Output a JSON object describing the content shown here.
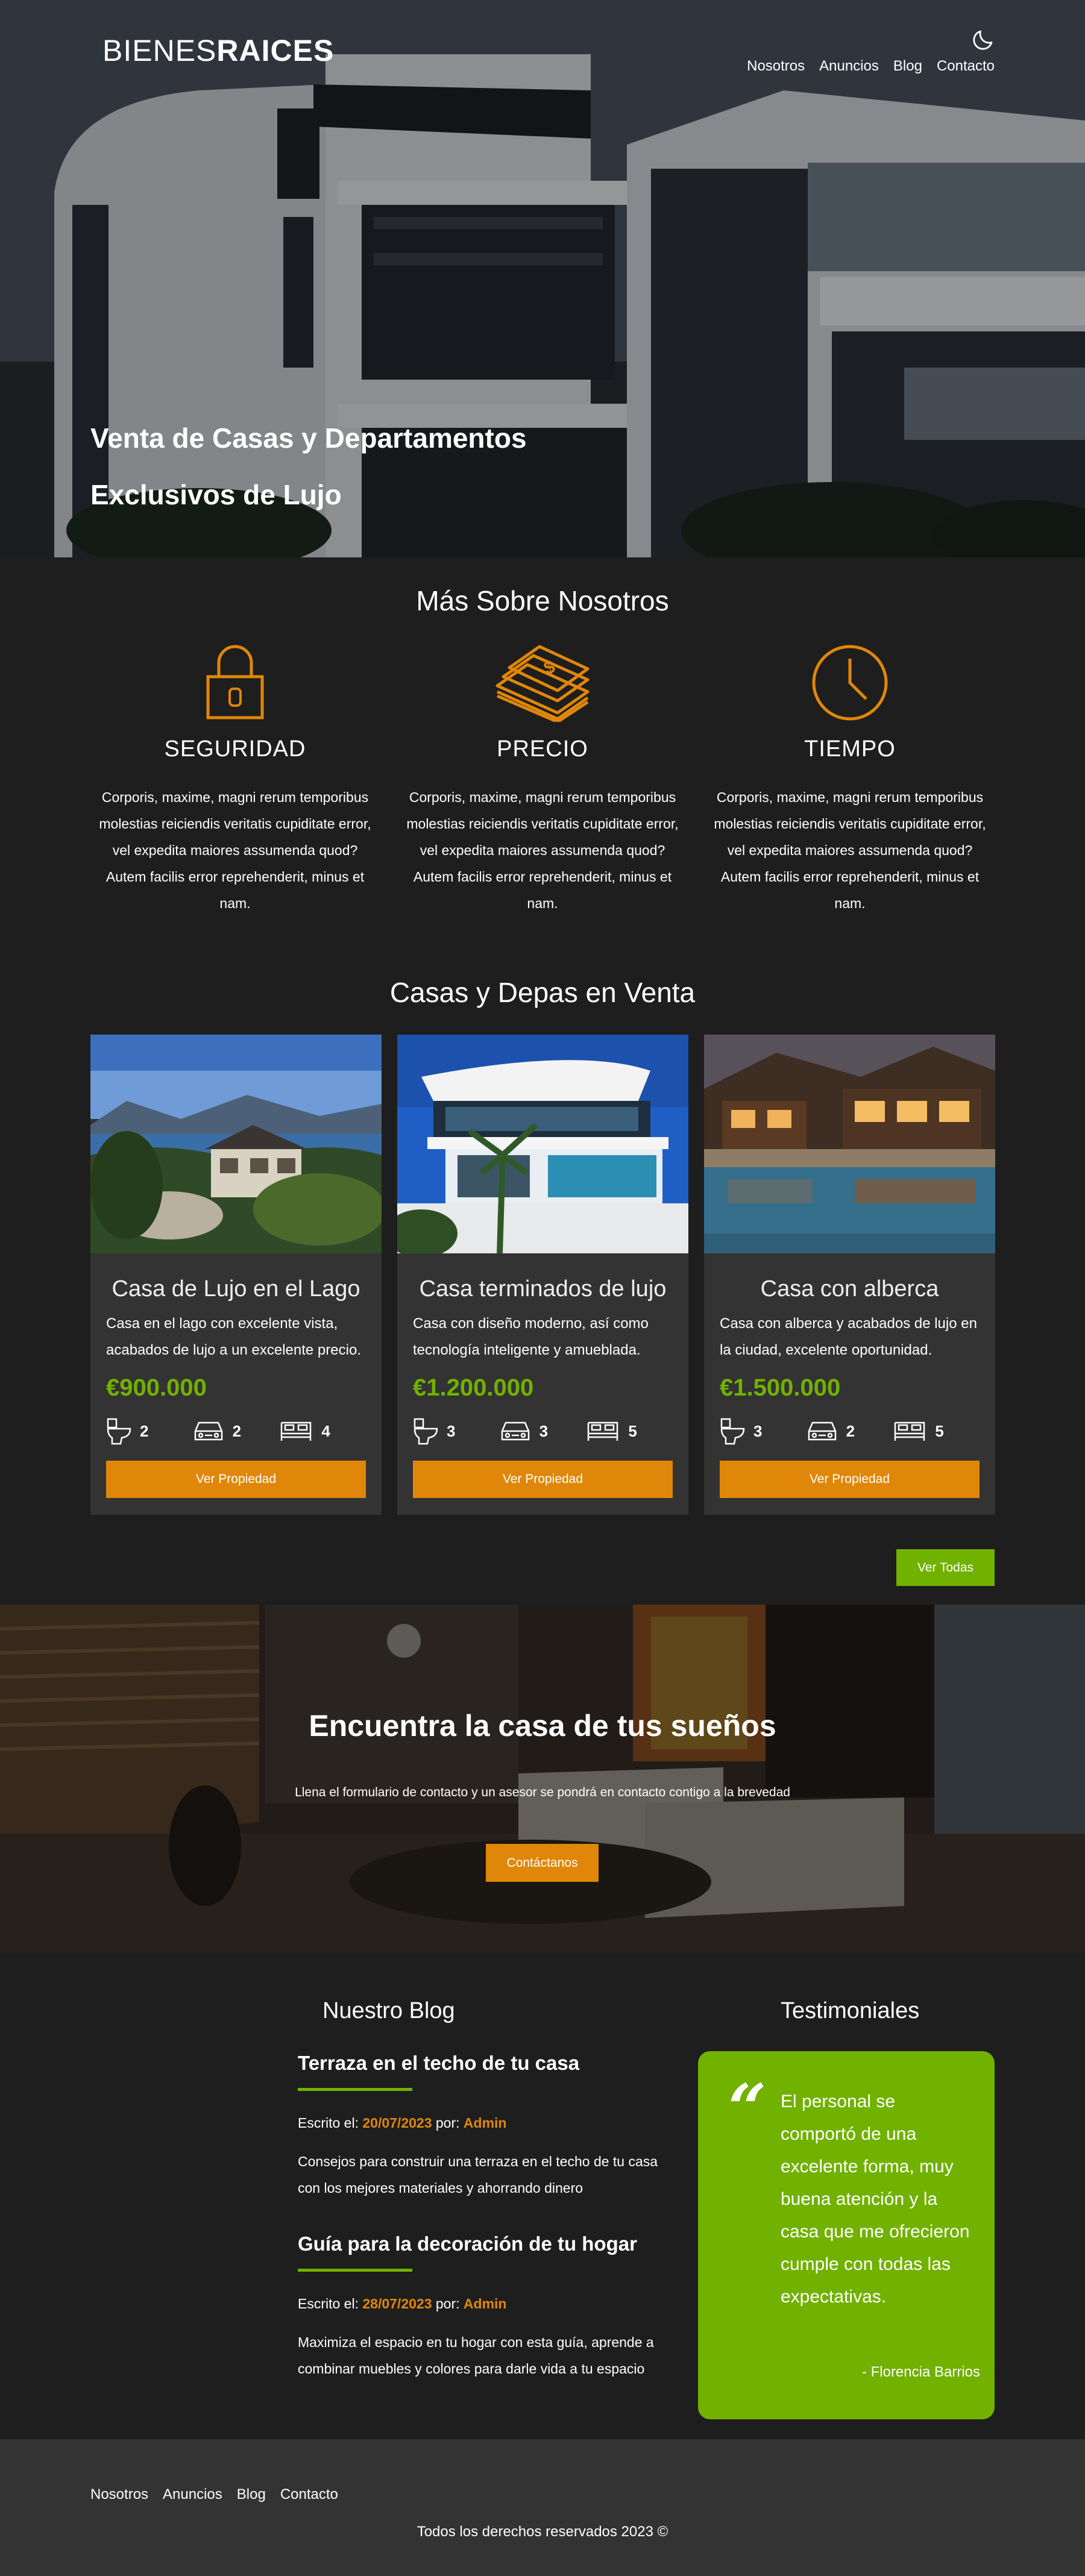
{
  "header": {
    "logo_light": "BIENES",
    "logo_bold": "RAICES",
    "nav": [
      "Nosotros",
      "Anuncios",
      "Blog",
      "Contacto"
    ],
    "hero_title": "Venta de Casas y Departamentos Exclusivos de Lujo"
  },
  "about": {
    "title": "Más Sobre Nosotros",
    "features": [
      {
        "icon": "lock-icon",
        "title": "SEGURIDAD",
        "text": "Corporis, maxime, magni rerum temporibus molestias reiciendis veritatis cupiditate error, vel expedita maiores assumenda quod? Autem facilis error reprehenderit, minus et nam."
      },
      {
        "icon": "money-icon",
        "title": "PRECIO",
        "text": "Corporis, maxime, magni rerum temporibus molestias reiciendis veritatis cupiditate error, vel expedita maiores assumenda quod? Autem facilis error reprehenderit, minus et nam."
      },
      {
        "icon": "clock-icon",
        "title": "TIEMPO",
        "text": "Corporis, maxime, magni rerum temporibus molestias reiciendis veritatis cupiditate error, vel expedita maiores assumenda quod? Autem facilis error reprehenderit, minus et nam."
      }
    ]
  },
  "listings": {
    "title": "Casas y Depas en Venta",
    "items": [
      {
        "title": "Casa de Lujo en el Lago",
        "description": "Casa en el lago con excelente vista, acabados de lujo a un excelente precio.",
        "price": "€900.000",
        "wc": "2",
        "parking": "2",
        "bedrooms": "4",
        "button": "Ver Propiedad"
      },
      {
        "title": "Casa terminados de lujo",
        "description": "Casa con diseño moderno, así como tecnología inteligente y amueblada.",
        "price": "€1.200.000",
        "wc": "3",
        "parking": "3",
        "bedrooms": "5",
        "button": "Ver Propiedad"
      },
      {
        "title": "Casa con alberca",
        "description": "Casa con alberca y acabados de lujo en la ciudad, excelente oportunidad.",
        "price": "€1.500.000",
        "wc": "3",
        "parking": "2",
        "bedrooms": "5",
        "button": "Ver Propiedad"
      }
    ],
    "see_all": "Ver Todas"
  },
  "contact_banner": {
    "title": "Encuentra la casa de tus sueños",
    "text": "Llena el formulario de contacto y un asesor se pondrá en contacto contigo a la brevedad",
    "button": "Contáctanos"
  },
  "blog": {
    "title": "Nuestro Blog",
    "entries": [
      {
        "title": "Terraza en el techo de tu casa",
        "meta_prefix": "Escrito el: ",
        "date": "20/07/2023",
        "by": " por: ",
        "author": "Admin",
        "text": "Consejos para construir una terraza en el techo de tu casa con los mejores materiales y ahorrando dinero"
      },
      {
        "title": "Guía para la decoración de tu hogar",
        "meta_prefix": "Escrito el: ",
        "date": "28/07/2023",
        "by": " por: ",
        "author": "Admin",
        "text": "Maximiza el espacio en tu hogar con esta guía, aprende a combinar muebles y colores para darle vida a tu espacio"
      }
    ]
  },
  "testimonials": {
    "title": "Testimoniales",
    "quote_mark": "“",
    "text": "El personal se comportó de una excelente forma, muy buena atención y la casa que me ofrecieron cumple con todas las expectativas.",
    "author": "- Florencia Barrios"
  },
  "footer": {
    "nav": [
      "Nosotros",
      "Anuncios",
      "Blog",
      "Contacto"
    ],
    "copyright": "Todos los derechos reservados 2023 ©"
  },
  "colors": {
    "primary_orange": "#e08709",
    "accent_green": "#71b100",
    "dark_bg": "#1e1e1e",
    "card_bg": "#333333"
  }
}
